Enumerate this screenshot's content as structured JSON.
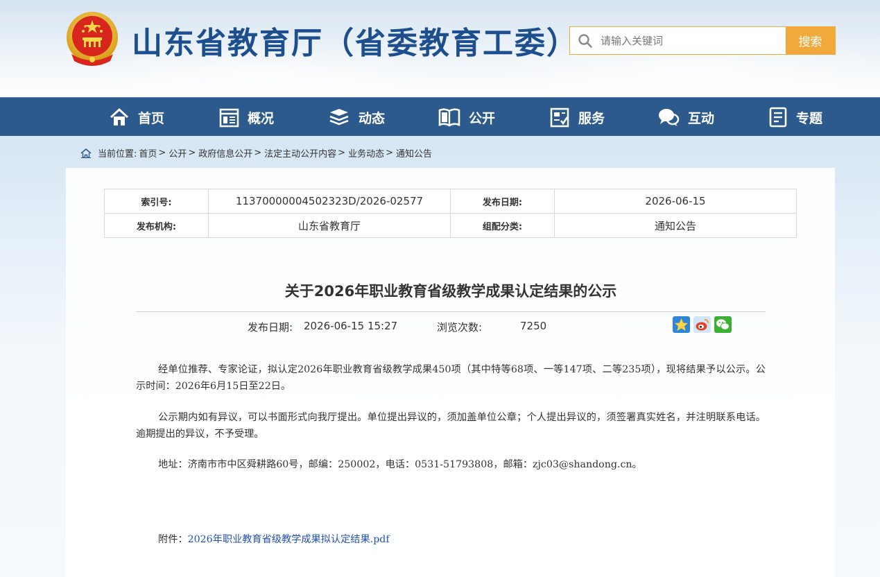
{
  "header": {
    "site_title": "山东省教育厅（省委教育工委）",
    "search_placeholder": "请输入关键词",
    "search_button": "搜索"
  },
  "nav": {
    "items": [
      {
        "label": "首页",
        "icon": "home-icon"
      },
      {
        "label": "概况",
        "icon": "overview-icon"
      },
      {
        "label": "动态",
        "icon": "news-stack-icon"
      },
      {
        "label": "公开",
        "icon": "open-book-icon"
      },
      {
        "label": "服务",
        "icon": "service-doc-icon"
      },
      {
        "label": "互动",
        "icon": "chat-bubbles-icon"
      },
      {
        "label": "专题",
        "icon": "topic-doc-icon"
      }
    ]
  },
  "breadcrumb": {
    "prefix": "当前位置:",
    "items": [
      "首页",
      "公开",
      "政府信息公开",
      "法定主动公开内容",
      "业务动态",
      "通知公告"
    ],
    "separator": ">"
  },
  "meta": {
    "index_label": "索引号:",
    "index_value": "11370000004502323D/2026-02577",
    "date_label": "发布日期:",
    "date_value": "2026-06-15",
    "org_label": "发布机构:",
    "org_value": "山东省教育厅",
    "category_label": "组配分类:",
    "category_value": "通知公告"
  },
  "article": {
    "title": "关于2026年职业教育省级教学成果认定结果的公示",
    "publish_label": "发布日期:",
    "publish_datetime": "2026-06-15 15:27",
    "views_label": "浏览次数:",
    "views_count": "7250",
    "share_icons": [
      "qzone-icon",
      "weibo-icon",
      "wechat-icon"
    ],
    "paragraphs": [
      "经单位推荐、专家论证，拟认定2026年职业教育省级教学成果450项（其中特等68项、一等147项、二等235项），现将结果予以公示。公示时间：2026年6月15日至22日。",
      "公示期内如有异议，可以书面形式向我厅提出。单位提出异议的，须加盖单位公章；个人提出异议的，须签署真实姓名，并注明联系电话。逾期提出的异议，不予受理。",
      "地址：济南市市中区舜耕路60号，邮编：250002，电话：0531-51793808，邮箱：zjc03@shandong.cn。"
    ],
    "attachment_label": "附件：",
    "attachment_link": "2026年职业教育省级教学成果拟认定结果.pdf"
  },
  "colors": {
    "nav_bg": "#2c5a8c",
    "title_blue": "#1d4f8f",
    "search_orange": "#f2a93b",
    "link_blue": "#2650b0"
  }
}
